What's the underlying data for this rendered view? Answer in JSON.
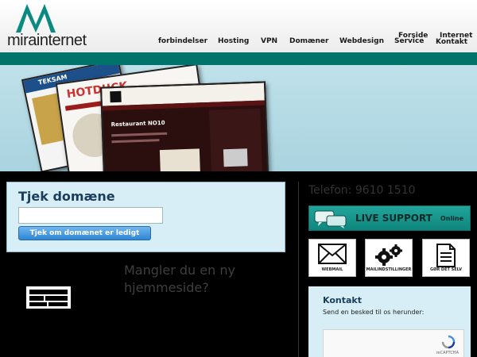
{
  "brand": {
    "name_part1": "mira",
    "name_part2": "internet"
  },
  "nav": {
    "items": [
      "forbindelser",
      "Hosting",
      "VPN",
      "Domæner",
      "Webdesign",
      "Service"
    ],
    "top_links": [
      "Forside",
      "Internet",
      "Kontakt"
    ]
  },
  "banner": {
    "screens": [
      "TEKSAM",
      "HOTDUCK",
      "Restaurant NO10"
    ]
  },
  "domain_check": {
    "title": "Tjek domæne",
    "input_value": "",
    "button_label": "Tjek om domænet er ledigt"
  },
  "promo": {
    "text": "Mangler du en ny hjemmeside?"
  },
  "sidebar": {
    "phone": "Telefon: 9610 1510",
    "live_support": {
      "label": "LIVE SUPPORT",
      "status": "Online"
    },
    "tiles": [
      {
        "label": "WEBMAIL",
        "icon": "envelope-icon"
      },
      {
        "label": "MAILINDSTILLINGER",
        "icon": "gears-icon"
      },
      {
        "label": "GØR DET SELV",
        "icon": "document-icon"
      }
    ],
    "contact": {
      "title": "Kontakt",
      "subtitle": "Send en besked til os herunder:",
      "captcha_label": "reCAPTCHA"
    }
  },
  "colors": {
    "teal": "#00736b",
    "banner": "#bfe1ea",
    "panel": "#d7eef6",
    "button": "#3d93dc"
  }
}
